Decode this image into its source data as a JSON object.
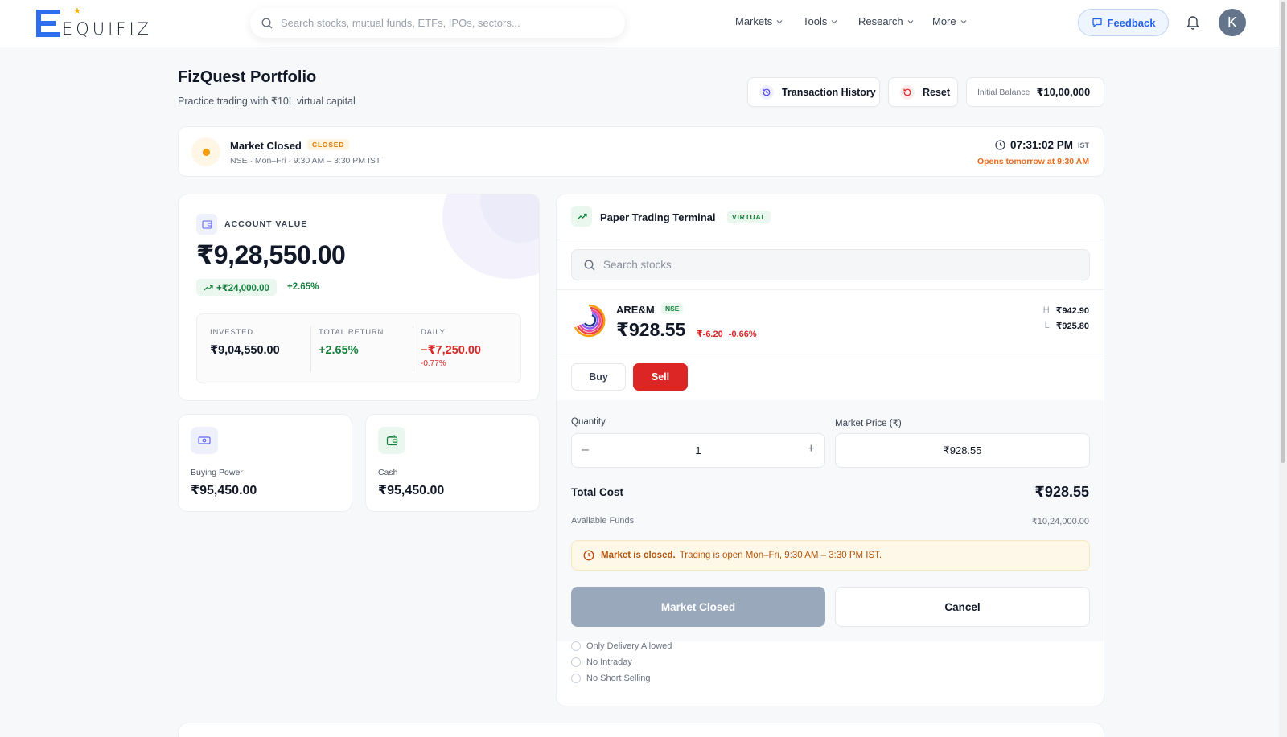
{
  "nav": {
    "logo_text": "EQUIFIZ",
    "search_placeholder": "Search stocks, mutual funds, ETFs, IPOs, sectors...",
    "menu": [
      {
        "label": "Markets"
      },
      {
        "label": "Tools"
      },
      {
        "label": "Research"
      },
      {
        "label": "More"
      }
    ],
    "feedback_label": "Feedback",
    "avatar_initial": "K",
    "icons": {
      "search": "search-icon",
      "bell": "bell-icon",
      "feedback": "chat-icon"
    }
  },
  "header": {
    "title": "FizQuest Portfolio",
    "subtitle": "Practice trading with ₹10L virtual capital",
    "transaction_history_label": "Transaction History",
    "reset_label": "Reset",
    "initial_balance_label": "Initial Balance",
    "initial_balance_value": "₹10,00,000"
  },
  "market_status": {
    "title": "Market Closed",
    "badge": "CLOSED",
    "schedule": "NSE · Mon–Fri · 9:30 AM – 3:30 PM IST",
    "time": "07:31:02 PM",
    "timezone": "IST",
    "opens_text": "Opens tomorrow at 9:30 AM",
    "status_color": "#f59e0b"
  },
  "account": {
    "label": "ACCOUNT VALUE",
    "value": "₹9,28,550.00",
    "gain_amount": "+₹24,000.00",
    "gain_percent": "+2.65%",
    "stats": {
      "invested_label": "INVESTED",
      "invested_value": "₹9,04,550.00",
      "total_return_label": "TOTAL RETURN",
      "total_return_value": "+2.65%",
      "daily_label": "DAILY",
      "daily_value": "−₹7,250.00",
      "daily_percent": "-0.77%"
    },
    "buying_power_label": "Buying Power",
    "buying_power_value": "₹95,450.00",
    "cash_label": "Cash",
    "cash_value": "₹95,450.00"
  },
  "terminal": {
    "title": "Paper Trading Terminal",
    "badge": "VIRTUAL",
    "search_placeholder": "Search stocks",
    "stock": {
      "symbol": "ARE&M",
      "exchange": "NSE",
      "price": "₹928.55",
      "change": "₹-6.20",
      "change_percent": "-0.66%",
      "high_label": "H",
      "high_value": "₹942.90",
      "low_label": "L",
      "low_value": "₹925.80"
    },
    "buy_label": "Buy",
    "sell_label": "Sell",
    "quantity_label": "Quantity",
    "quantity_value": "1",
    "quantity_minus": "–",
    "quantity_plus": "+",
    "market_price_label": "Market Price (₹)",
    "market_price_value": "₹928.55",
    "total_cost_label": "Total Cost",
    "total_cost_value": "₹928.55",
    "available_funds_label": "Available Funds",
    "available_funds_value": "₹10,24,000.00",
    "alert_bold": "Market is closed.",
    "alert_text": "Trading is open Mon–Fri, 9:30 AM – 3:30 PM IST.",
    "primary_button": "Market Closed",
    "cancel_button": "Cancel",
    "rules": [
      {
        "label": "Only Delivery Allowed"
      },
      {
        "label": "No Intraday"
      },
      {
        "label": "No Short Selling"
      }
    ],
    "colors": {
      "sell": "#dc2626",
      "positive": "#16803c",
      "negative": "#dc2626",
      "brand": "#2563eb"
    }
  }
}
